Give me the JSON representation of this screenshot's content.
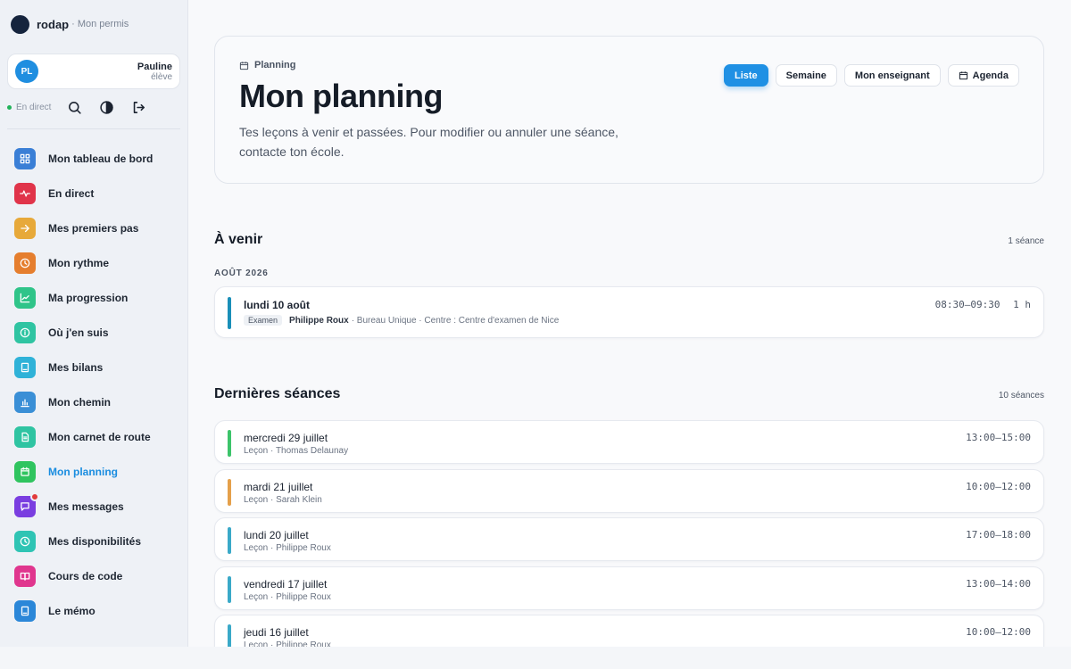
{
  "brand": {
    "name": "rodap",
    "sub": "· Mon permis"
  },
  "user": {
    "initials": "PL",
    "name": "Pauline",
    "role": "élève"
  },
  "tools": {
    "live": "En direct"
  },
  "nav": [
    {
      "label": "Mon tableau de bord",
      "icon": "grid-icon",
      "color": "#3a7fd6"
    },
    {
      "label": "En direct",
      "icon": "pulse-icon",
      "color": "#e0344a"
    },
    {
      "label": "Mes premiers pas",
      "icon": "arrow-right-icon",
      "color": "#e7a93a"
    },
    {
      "label": "Mon rythme",
      "icon": "clock-icon",
      "color": "#e57e2e"
    },
    {
      "label": "Ma progression",
      "icon": "trend-icon",
      "color": "#2fc489"
    },
    {
      "label": "Où j'en suis",
      "icon": "info-icon",
      "color": "#2fc4a2"
    },
    {
      "label": "Mes bilans",
      "icon": "book-icon",
      "color": "#2fb2d8"
    },
    {
      "label": "Mon chemin",
      "icon": "bar-chart-icon",
      "color": "#3a8fd6"
    },
    {
      "label": "Mon carnet de route",
      "icon": "document-icon",
      "color": "#2fc4a2"
    },
    {
      "label": "Mon planning",
      "icon": "calendar-icon",
      "color": "#2fc45f",
      "active": true
    },
    {
      "label": "Mes messages",
      "icon": "message-icon",
      "color": "#7a3ee0",
      "badge": true
    },
    {
      "label": "Mes disponibilités",
      "icon": "clock-icon",
      "color": "#2fc4b4"
    },
    {
      "label": "Cours de code",
      "icon": "open-book-icon",
      "color": "#e0368e"
    },
    {
      "label": "Le mémo",
      "icon": "book-icon",
      "color": "#2b87d8"
    }
  ],
  "hero": {
    "crumb": "Planning",
    "title": "Mon planning",
    "description": "Tes leçons à venir et passées. Pour modifier ou annuler une séance, contacte ton école.",
    "tabs": [
      {
        "label": "Liste",
        "active": true
      },
      {
        "label": "Semaine"
      },
      {
        "label": "Mon enseignant"
      },
      {
        "label": "Agenda",
        "icon": "calendar-icon"
      }
    ]
  },
  "upcoming": {
    "title": "À venir",
    "count": "1 séance",
    "month": "AOÛT 2026",
    "items": [
      {
        "date": "lundi 10 août",
        "tag": "Examen",
        "teacher": "Philippe Roux",
        "details": "· Bureau Unique · Centre : Centre d'examen de Nice",
        "time": "08:30–09:30",
        "duration": "1 h",
        "color": "#1a8fb8"
      }
    ]
  },
  "past": {
    "title": "Dernières séances",
    "count": "10 séances",
    "items": [
      {
        "date": "mercredi 29 juillet",
        "sub": "Leçon · Thomas Delaunay",
        "time": "13:00–15:00",
        "color": "#3cc46a"
      },
      {
        "date": "mardi 21 juillet",
        "sub": "Leçon · Sarah Klein",
        "time": "10:00–12:00",
        "color": "#e5a04a"
      },
      {
        "date": "lundi 20 juillet",
        "sub": "Leçon · Philippe Roux",
        "time": "17:00–18:00",
        "color": "#3aa9c8"
      },
      {
        "date": "vendredi 17 juillet",
        "sub": "Leçon · Philippe Roux",
        "time": "13:00–14:00",
        "color": "#3aa9c8"
      },
      {
        "date": "jeudi 16 juillet",
        "sub": "Leçon · Philippe Roux",
        "time": "10:00–12:00",
        "color": "#3aa9c8"
      }
    ]
  }
}
